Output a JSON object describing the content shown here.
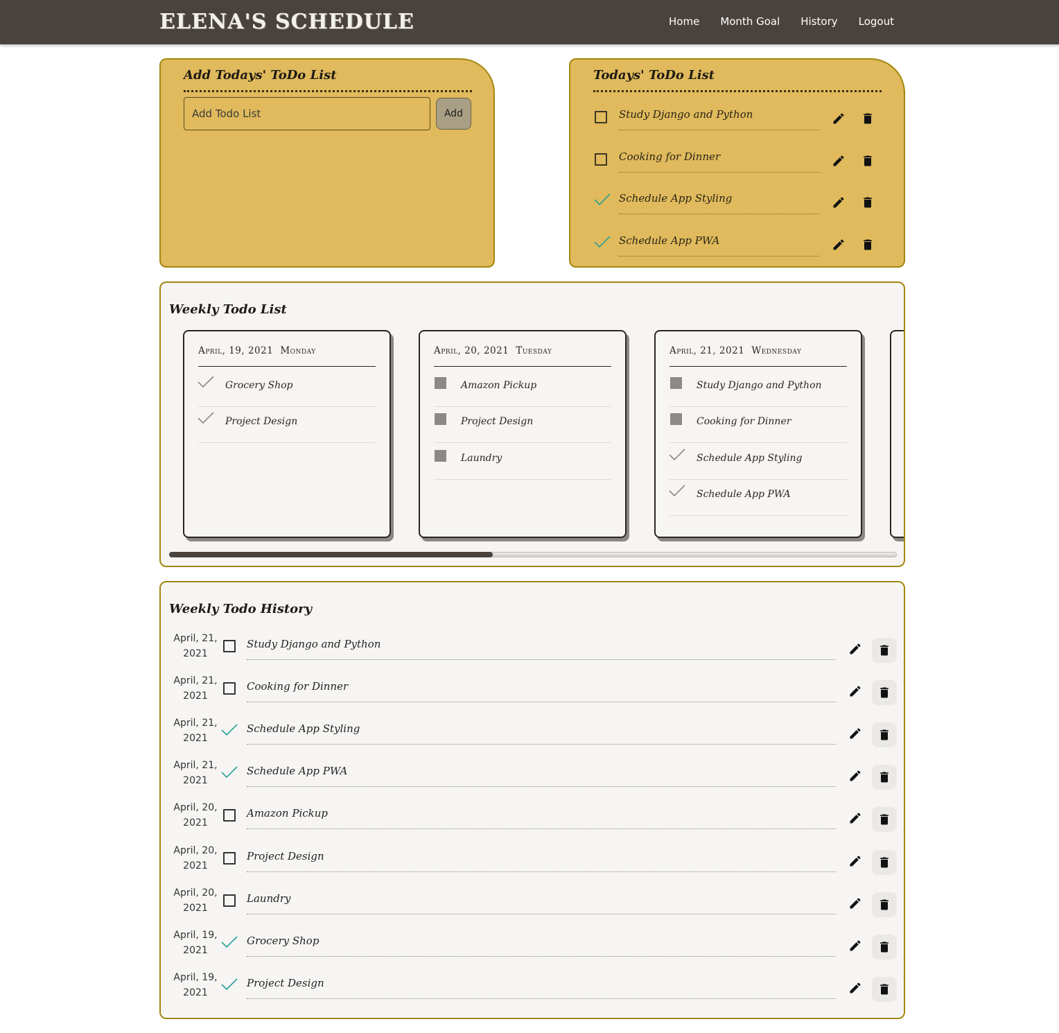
{
  "nav": {
    "brand": "ELENA'S SCHEDULE",
    "links": [
      "Home",
      "Month Goal",
      "History",
      "Logout"
    ]
  },
  "add_card": {
    "title": "Add Todays' ToDo List",
    "input_placeholder": "Add Todo List",
    "add_label": "Add"
  },
  "today_card": {
    "title": "Todays' ToDo List",
    "items": [
      {
        "text": "Study Django and Python",
        "done": false
      },
      {
        "text": "Cooking for Dinner",
        "done": false
      },
      {
        "text": "Schedule App Styling",
        "done": true
      },
      {
        "text": "Schedule App PWA",
        "done": true
      }
    ]
  },
  "weekly": {
    "title": "Weekly Todo List",
    "days": [
      {
        "date": "April, 19, 2021",
        "weekday": "Monday",
        "items": [
          {
            "text": "Grocery Shop",
            "done": true
          },
          {
            "text": "Project Design",
            "done": true
          }
        ]
      },
      {
        "date": "April, 20, 2021",
        "weekday": "Tuesday",
        "items": [
          {
            "text": "Amazon Pickup",
            "done": false
          },
          {
            "text": "Project Design",
            "done": false
          },
          {
            "text": "Laundry",
            "done": false
          }
        ]
      },
      {
        "date": "April, 21, 2021",
        "weekday": "Wednesday",
        "items": [
          {
            "text": "Study Django and Python",
            "done": false
          },
          {
            "text": "Cooking for Dinner",
            "done": false
          },
          {
            "text": "Schedule App Styling",
            "done": true
          },
          {
            "text": "Schedule App PWA",
            "done": true
          }
        ]
      }
    ],
    "scroll_fraction": 0.445
  },
  "history": {
    "title": "Weekly Todo History",
    "rows": [
      {
        "date_line1": "April, 21,",
        "date_line2": "2021",
        "text": "Study Django and Python",
        "done": false
      },
      {
        "date_line1": "April, 21,",
        "date_line2": "2021",
        "text": "Cooking for Dinner",
        "done": false
      },
      {
        "date_line1": "April, 21,",
        "date_line2": "2021",
        "text": "Schedule App Styling",
        "done": true
      },
      {
        "date_line1": "April, 21,",
        "date_line2": "2021",
        "text": "Schedule App PWA",
        "done": true
      },
      {
        "date_line1": "April, 20,",
        "date_line2": "2021",
        "text": "Amazon Pickup",
        "done": false
      },
      {
        "date_line1": "April, 20,",
        "date_line2": "2021",
        "text": "Project Design",
        "done": false
      },
      {
        "date_line1": "April, 20,",
        "date_line2": "2021",
        "text": "Laundry",
        "done": false
      },
      {
        "date_line1": "April, 19,",
        "date_line2": "2021",
        "text": "Grocery Shop",
        "done": true
      },
      {
        "date_line1": "April, 19,",
        "date_line2": "2021",
        "text": "Project Design",
        "done": true
      }
    ]
  },
  "colors": {
    "nav_bg": "#4a433d",
    "gold": "#e0ba5c",
    "gold_border": "#a38610",
    "check_teal": "#2aa198",
    "check_grey": "#8c8986"
  },
  "icons": {
    "edit": "pencil-icon",
    "delete": "trash-icon",
    "done": "check-icon",
    "todo": "checkbox-icon"
  }
}
